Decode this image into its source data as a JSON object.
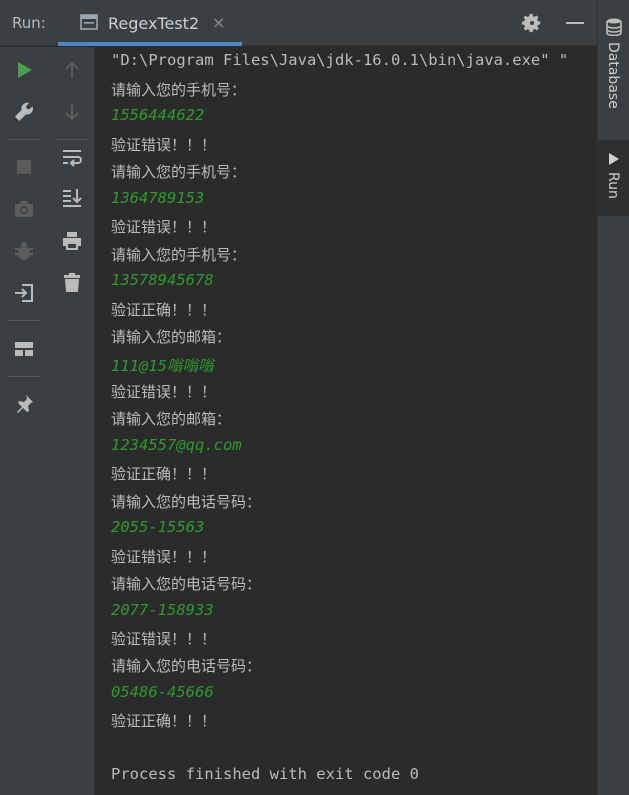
{
  "header": {
    "run_label": "Run:",
    "tab_label": "RegexTest2",
    "tab_close": "×"
  },
  "right_strip": {
    "database_label": "Database",
    "run_label": "Run"
  },
  "console": {
    "command": "\"D:\\Program Files\\Java\\jdk-16.0.1\\bin\\java.exe\" \"",
    "lines": [
      {
        "type": "out",
        "text": "请输入您的手机号："
      },
      {
        "type": "in",
        "text": "1556444622"
      },
      {
        "type": "out",
        "text": "验证错误！！！"
      },
      {
        "type": "out",
        "text": "请输入您的手机号："
      },
      {
        "type": "in",
        "text": "1364789153"
      },
      {
        "type": "out",
        "text": "验证错误！！！"
      },
      {
        "type": "out",
        "text": "请输入您的手机号："
      },
      {
        "type": "in",
        "text": "13578945678"
      },
      {
        "type": "out",
        "text": "验证正确！！！"
      },
      {
        "type": "out",
        "text": "请输入您的邮箱："
      },
      {
        "type": "in",
        "text": "111@15嗡嗡嗡"
      },
      {
        "type": "out",
        "text": "验证错误！！！"
      },
      {
        "type": "out",
        "text": "请输入您的邮箱："
      },
      {
        "type": "in",
        "text": "1234557@qq.com"
      },
      {
        "type": "out",
        "text": "验证正确！！！"
      },
      {
        "type": "out",
        "text": "请输入您的电话号码："
      },
      {
        "type": "in",
        "text": "2055-15563"
      },
      {
        "type": "out",
        "text": "验证错误！！！"
      },
      {
        "type": "out",
        "text": "请输入您的电话号码："
      },
      {
        "type": "in",
        "text": "2077-158933"
      },
      {
        "type": "out",
        "text": "验证错误！！！"
      },
      {
        "type": "out",
        "text": "请输入您的电话号码："
      },
      {
        "type": "in",
        "text": "05486-45666"
      },
      {
        "type": "out",
        "text": "验证正确！！！"
      }
    ],
    "footer": "Process finished with exit code 0"
  },
  "colors": {
    "input_text": "#2e9a2e",
    "run_green": "#499c54",
    "accent": "#4a88c7"
  }
}
